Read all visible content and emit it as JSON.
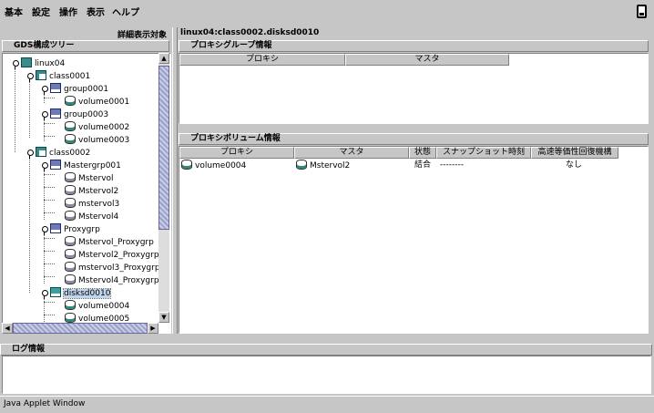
{
  "menubar": {
    "items": [
      "基本",
      "設定",
      "操作",
      "表示",
      "ヘルプ"
    ]
  },
  "left": {
    "detail_label": "詳細表示対象",
    "tree_title": "GDS構成ツリー",
    "tree": [
      {
        "label": "linux04",
        "icon": "server-icon"
      },
      {
        "label": "class0001",
        "icon": "class-icon"
      },
      {
        "label": "group0001",
        "icon": "group-icon"
      },
      {
        "label": "volume0001",
        "icon": "volume-icon"
      },
      {
        "label": "group0003",
        "icon": "group-icon"
      },
      {
        "label": "volume0002",
        "icon": "volume-icon"
      },
      {
        "label": "volume0003",
        "icon": "volume-icon"
      },
      {
        "label": "class0002",
        "icon": "class-icon"
      },
      {
        "label": "Mastergrp001",
        "icon": "group-icon"
      },
      {
        "label": "Mstervol",
        "icon": "volume-icon"
      },
      {
        "label": "Mstervol2",
        "icon": "volume-icon"
      },
      {
        "label": "mstervol3",
        "icon": "volume-icon"
      },
      {
        "label": "Mstervol4",
        "icon": "volume-icon"
      },
      {
        "label": "Proxygrp",
        "icon": "group-icon"
      },
      {
        "label": "Mstervol_Proxygrp",
        "icon": "volume-icon"
      },
      {
        "label": "Mstervol2_Proxygrp",
        "icon": "volume-icon"
      },
      {
        "label": "mstervol3_Proxygrp",
        "icon": "volume-icon"
      },
      {
        "label": "Mstervol4_Proxygrp",
        "icon": "volume-icon"
      },
      {
        "label": "disksd0010",
        "icon": "disk-icon"
      },
      {
        "label": "volume0004",
        "icon": "volume-icon"
      },
      {
        "label": "volume0005",
        "icon": "volume-icon"
      }
    ]
  },
  "right": {
    "breadcrumb": "linux04:class0002.disksd0010",
    "proxy_group": {
      "title": "プロキシグループ情報",
      "columns": [
        "プロキシ",
        "マスタ"
      ]
    },
    "proxy_volume": {
      "title": "プロキシボリューム情報",
      "columns": [
        "プロキシ",
        "マスタ",
        "状態",
        "スナップショット時刻",
        "高速等価性回復機構"
      ],
      "rows": [
        {
          "proxy": "volume0004",
          "master": "Mstervol2",
          "state": "結合",
          "snapshot": "--------",
          "fast_recovery": "なし"
        }
      ]
    }
  },
  "log": {
    "title": "ログ情報"
  },
  "status_bar": {
    "text": "Java Applet Window"
  }
}
